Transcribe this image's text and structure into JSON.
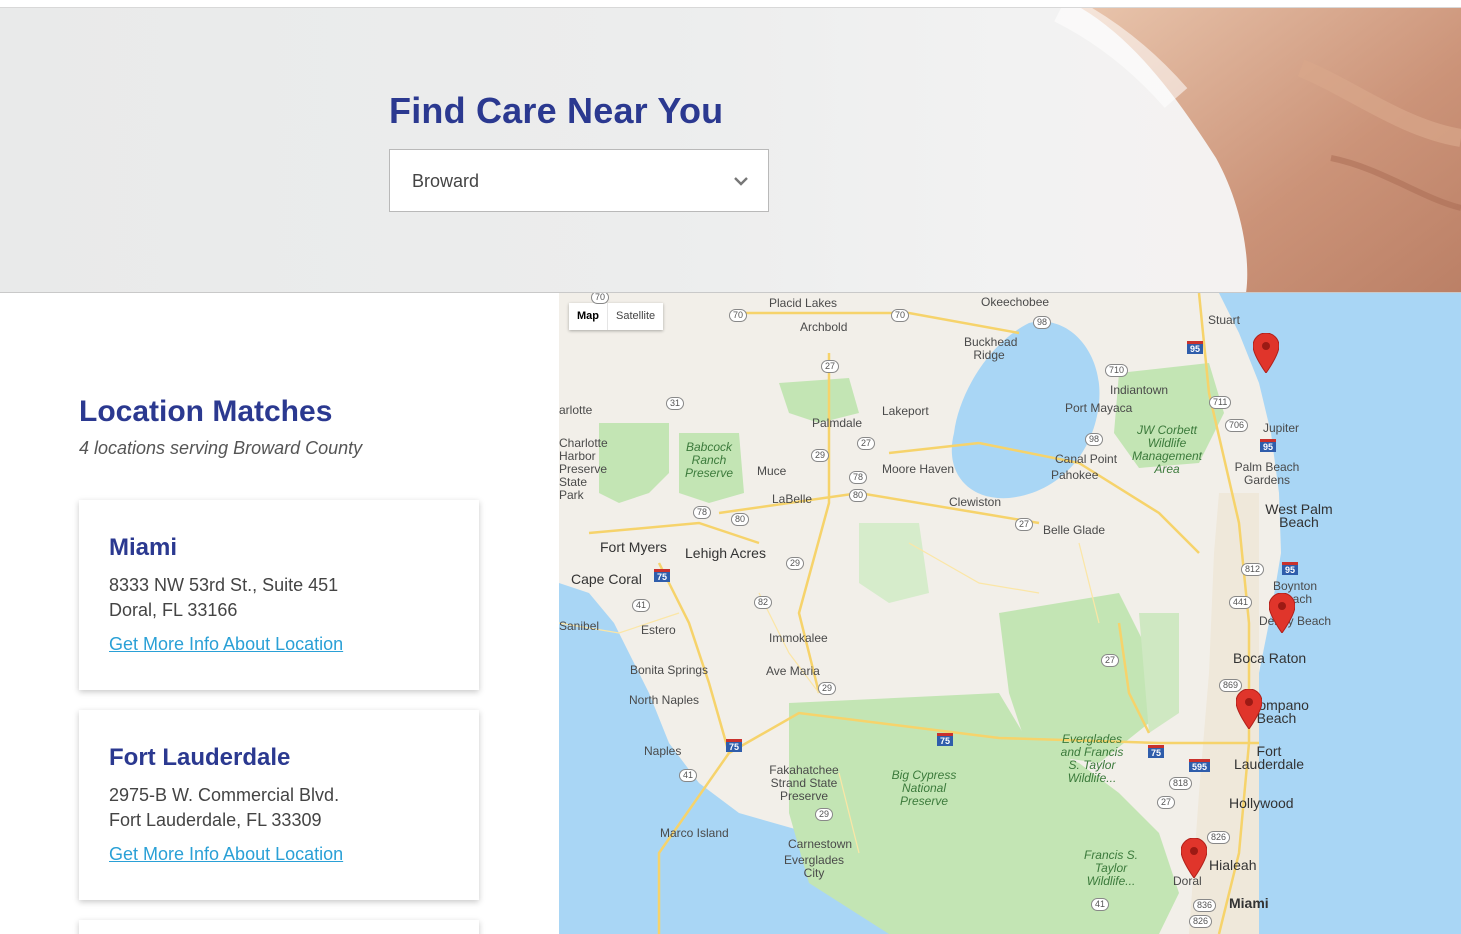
{
  "hero": {
    "title": "Find Care Near You",
    "county_select": {
      "value": "Broward"
    }
  },
  "matches": {
    "title": "Location Matches",
    "subtitle": "4 locations serving Broward County",
    "locations": [
      {
        "name": "Miami",
        "address_line1": "8333 NW 53rd St., Suite 451",
        "address_line2": "Doral, FL 33166",
        "link": "Get More Info About Location"
      },
      {
        "name": "Fort Lauderdale",
        "address_line1": "2975-B W. Commercial Blvd.",
        "address_line2": "Fort Lauderdale, FL 33309",
        "link": "Get More Info About Location"
      }
    ]
  },
  "map": {
    "type_toggle": [
      "Map",
      "Satellite"
    ],
    "places": [
      "Placid Lakes",
      "Archbold",
      "Okeechobee",
      "Buckhead Ridge",
      "Stuart",
      "Indiantown",
      "Port Mayaca",
      "Lakeport",
      "Palmdale",
      "Jupiter",
      "JW Corbett Wildlife Management Area",
      "Canal Point",
      "Pahokee",
      "Palm Beach Gardens",
      "Charlotte Harbor Preserve State Park",
      "Babcock Ranch Preserve",
      "Muce",
      "Moore Haven",
      "LaBelle",
      "Clewiston",
      "West Palm Beach",
      "Belle Glade",
      "Fort Myers",
      "Lehigh Acres",
      "Cape Coral",
      "Boynton Beach",
      "Delray Beach",
      "Sanibel",
      "Estero",
      "Immokalee",
      "Boca Raton",
      "Bonita Springs",
      "Ave Maria",
      "Pompano Beach",
      "North Naples",
      "Naples",
      "Everglades and Francis S. Taylor Wildlife...",
      "Fort Lauderdale",
      "Fakahatchee Strand State Preserve",
      "Big Cypress National Preserve",
      "Hollywood",
      "Marco Island",
      "Carnestown",
      "Everglades City",
      "Francis S. Taylor Wildlife...",
      "Hialeah",
      "Doral",
      "Miami",
      "arlotte"
    ],
    "markers": [
      "Stuart",
      "Delray Beach",
      "Pompano Beach",
      "Doral"
    ],
    "colors": {
      "water": "#a9d6f5",
      "land": "#f2efe9",
      "park": "#c3e5b4",
      "road": "#f6d36b",
      "marker": "#e0352b"
    }
  }
}
